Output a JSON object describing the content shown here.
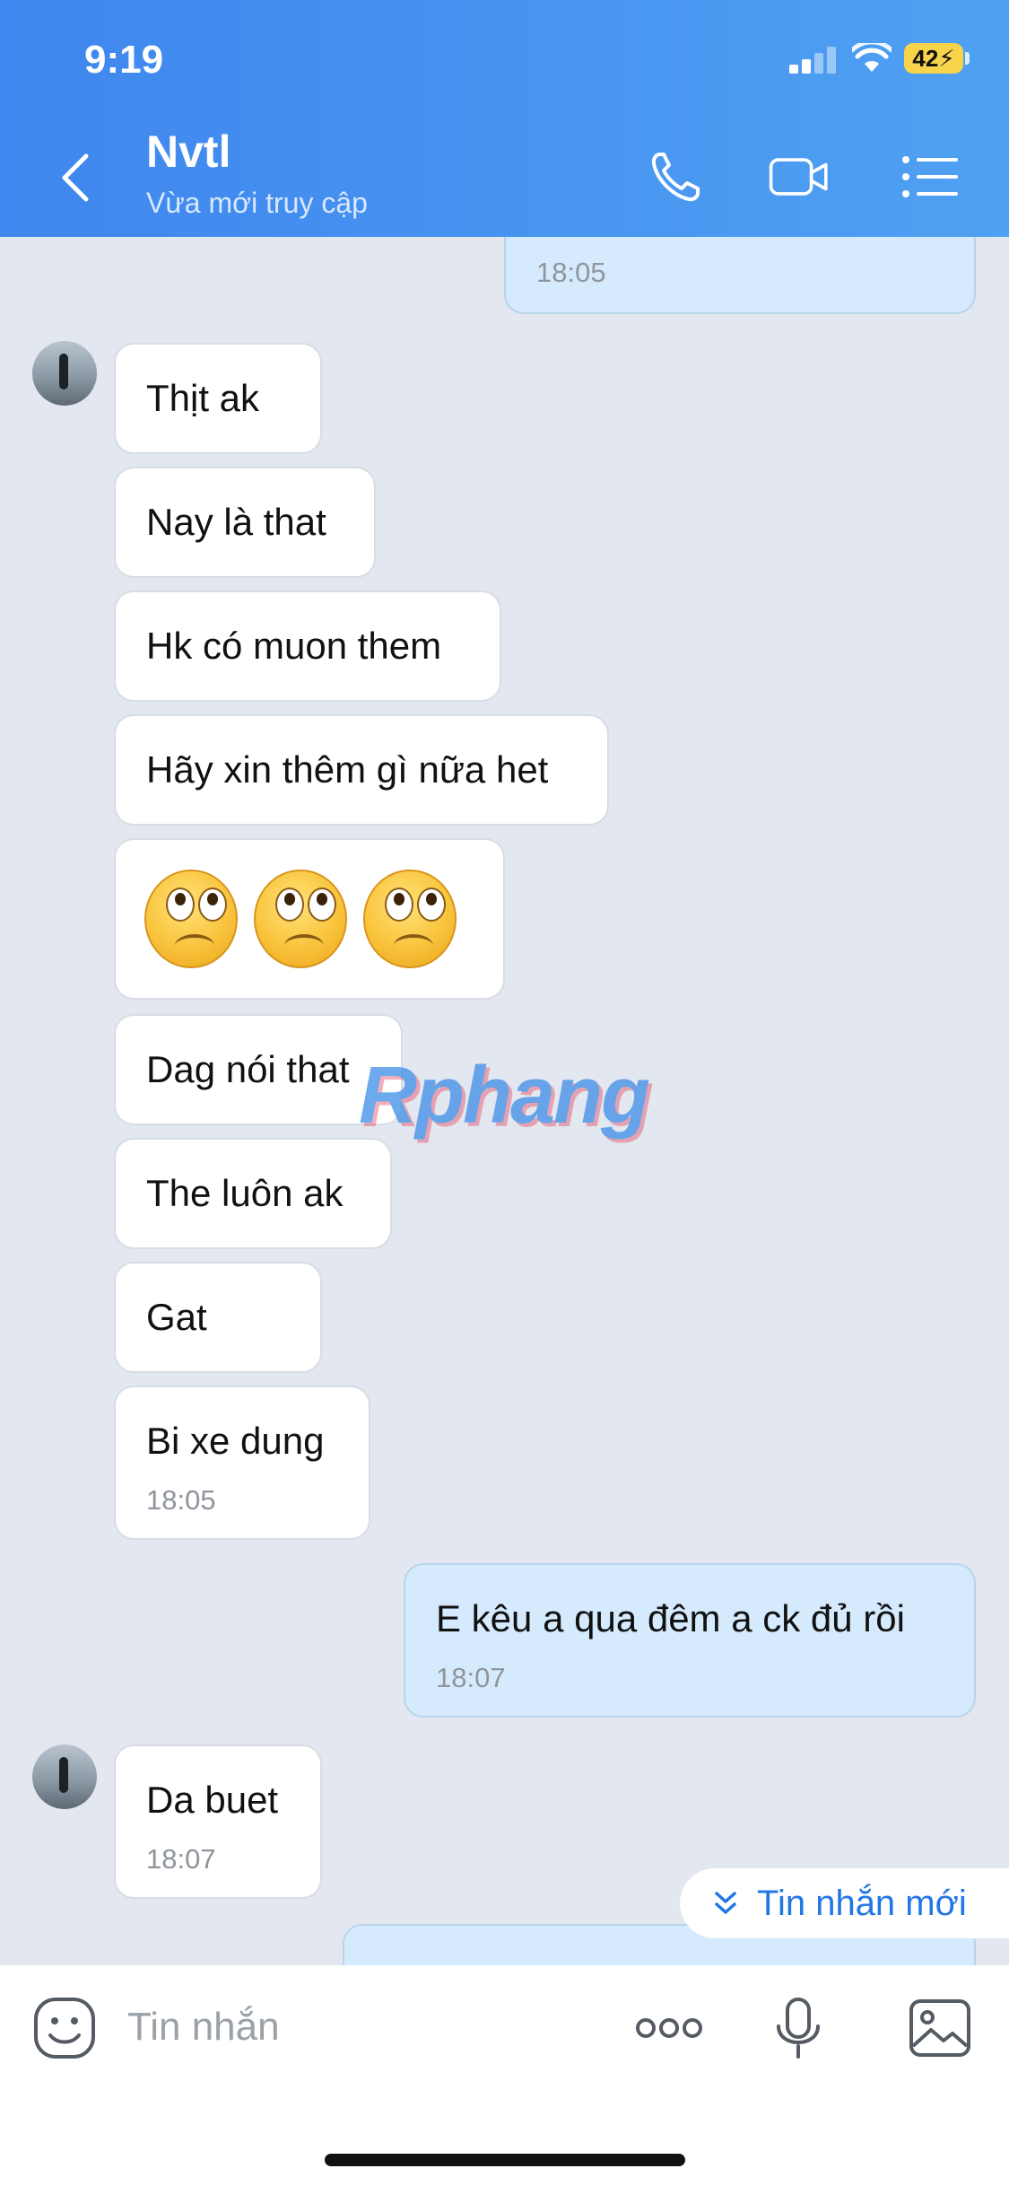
{
  "status_bar": {
    "time": "9:19",
    "battery": "42"
  },
  "header": {
    "contact_name": "Nvtl",
    "contact_status": "Vừa mới truy cập"
  },
  "messages": [
    {
      "side": "out",
      "time": "18:05"
    },
    {
      "side": "in",
      "text": "Thịt ak"
    },
    {
      "side": "in",
      "text": "Nay là that"
    },
    {
      "side": "in",
      "text": "Hk có muon them"
    },
    {
      "side": "in",
      "text": "Hãy xin thêm gì nữa het"
    },
    {
      "side": "in",
      "emoji": [
        "sad-face",
        "sad-face",
        "sad-face"
      ]
    },
    {
      "side": "in",
      "text": "Dag nói that"
    },
    {
      "side": "in",
      "text": "The luôn ak"
    },
    {
      "side": "in",
      "text": "Gat"
    },
    {
      "side": "in",
      "text": "Bi xe dung",
      "time": "18:05"
    },
    {
      "side": "out",
      "text": "E kêu a qua đêm a ck đủ rồi",
      "time": "18:07"
    },
    {
      "side": "in",
      "text": "Da buet",
      "time": "18:07"
    }
  ],
  "new_message_pill": "Tin nhắn mới",
  "watermark": "Rphang",
  "input": {
    "placeholder": "Tin nhắn"
  },
  "colors": {
    "header": "#3f86ee",
    "outgoing_bubble": "#d5ebfd",
    "link": "#2277e6",
    "background": "#e3e7ef"
  }
}
